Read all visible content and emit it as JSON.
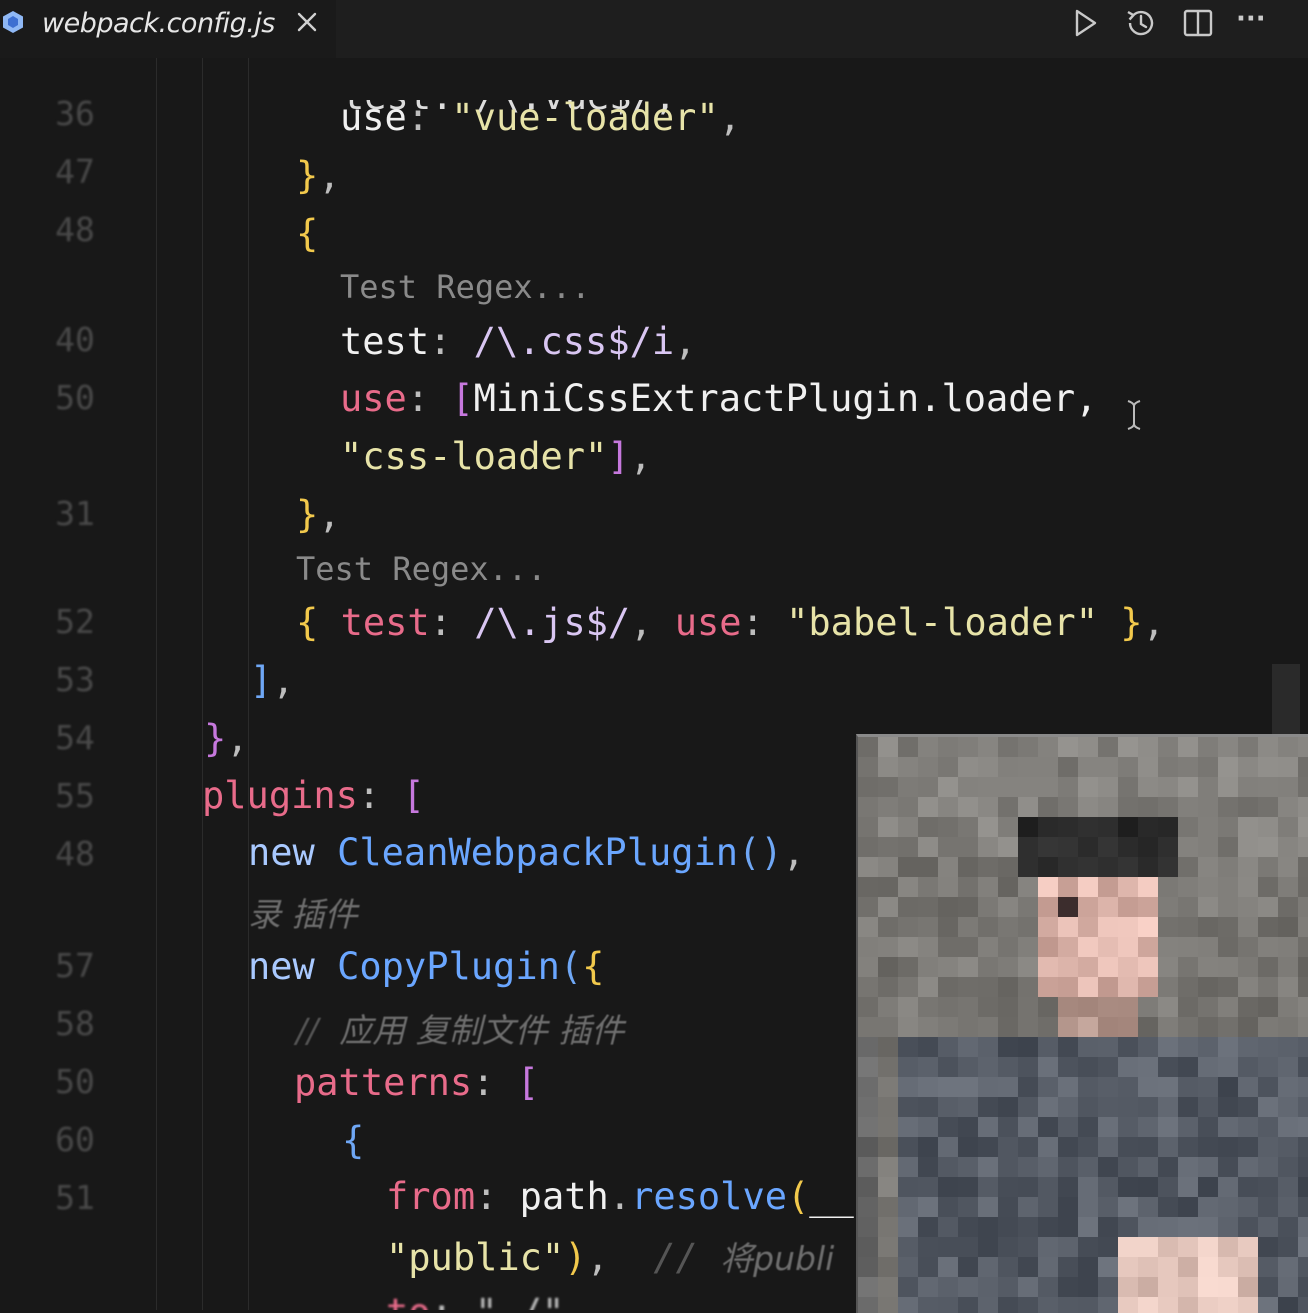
{
  "tab": {
    "filename": "webpack.config.js"
  },
  "toolbar": {
    "more": "···"
  },
  "line_numbers": [
    "36",
    "47",
    "48",
    "40",
    "50",
    "31",
    "52",
    "53",
    "54",
    "55",
    "48",
    "57",
    "58",
    "50",
    "60",
    "51"
  ],
  "code": {
    "l0": "test: /\\.vue$/,",
    "l1_key": "use",
    "l1_val": "\"vue-loader\"",
    "hint1": "Test Regex...",
    "l4_key": "test",
    "l4_val": "/\\.css$/i",
    "l5_key": "use",
    "l5_val": "MiniCssExtractPlugin.loader,",
    "l6_val": "\"css-loader\"",
    "hint2": "Test Regex...",
    "l8_test": "test",
    "l8_regex": "/\\.js$/",
    "l8_use": "use",
    "l8_val": "\"babel-loader\"",
    "l11_key": "plugins",
    "l12_new": "new",
    "l12_fn": "CleanWebpackPlugin",
    "comment1": "录 插件",
    "l13_new": "new",
    "l13_fn": "CopyPlugin",
    "comment2": "应用 复制文件 插件",
    "l15_key": "patterns",
    "l17_key": "from",
    "l17_obj": "path",
    "l17_fn": "resolve",
    "l17_arg": "__",
    "l18_val": "\"public\"",
    "comment3": "将publi"
  },
  "colors": {
    "background": "#181818",
    "key": "#e86b8a",
    "string": "#e7e3a8",
    "function": "#6aa6ff",
    "brace": "#f2c94c"
  },
  "webcam": {
    "description_icon": "webcam-video-icon"
  }
}
